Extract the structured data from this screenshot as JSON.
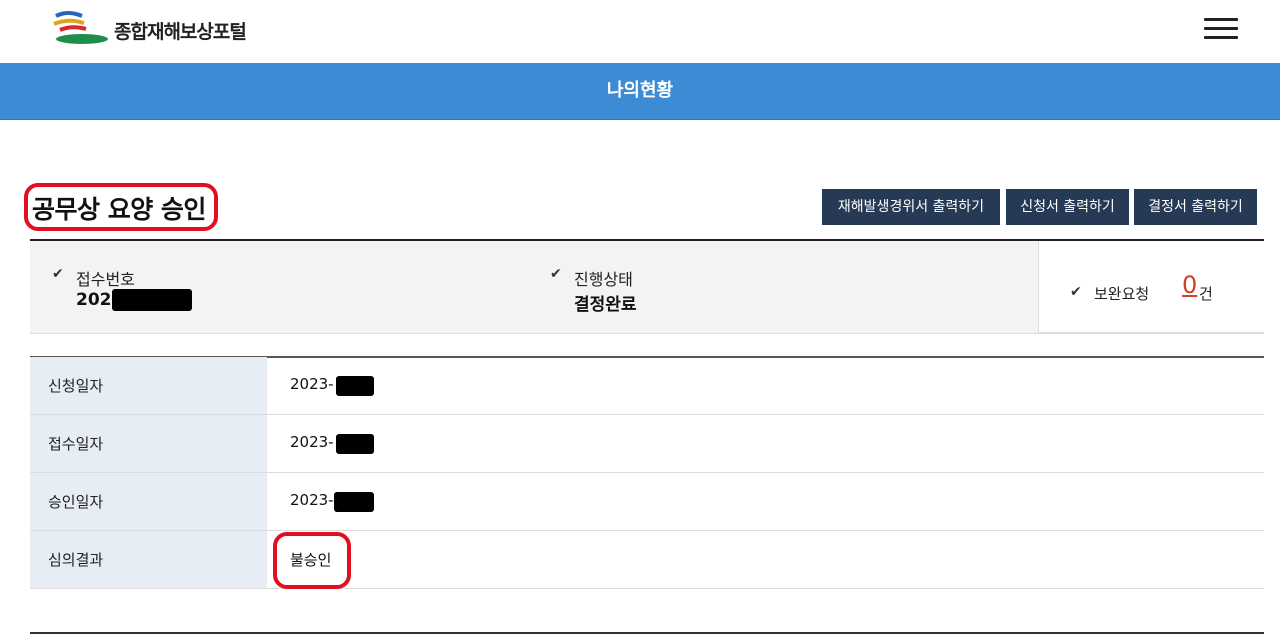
{
  "header": {
    "logo_text": "종합재해보상포털"
  },
  "banner": {
    "title": "나의현황"
  },
  "page": {
    "title": "공무상 요양 승인"
  },
  "buttons": {
    "print_accident": "재해발생경위서 출력하기",
    "print_application": "신청서 출력하기",
    "print_decision": "결정서 출력하기"
  },
  "status": {
    "receipt_label": "접수번호",
    "receipt_value": "202",
    "progress_label": "진행상태",
    "progress_value": "결정완료",
    "supplement_label": "보완요청",
    "supplement_count": "0",
    "supplement_unit": "건"
  },
  "details": [
    {
      "label": "신청일자",
      "value": "2023-"
    },
    {
      "label": "접수일자",
      "value": "2023-"
    },
    {
      "label": "승인일자",
      "value": "2023-"
    },
    {
      "label": "심의결과",
      "value": "불승인"
    }
  ],
  "colors": {
    "banner": "#3c8bd4",
    "button": "#263a56",
    "highlight": "#e01020",
    "count": "#d0402a"
  }
}
